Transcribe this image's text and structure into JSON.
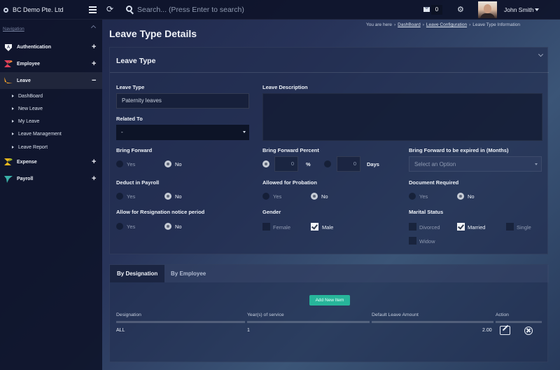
{
  "header": {
    "company": "BC Demo Pte. Ltd",
    "search_placeholder": "Search... (Press Enter to search)",
    "mail_count": "0",
    "user_name": "John Smith",
    "icons": [
      "hamburger-icon",
      "refresh-icon",
      "search-icon",
      "mail-icon",
      "gear-icon",
      "caret-down-icon"
    ]
  },
  "sidebar": {
    "title": "Navigation",
    "items": [
      {
        "label": "Authentication",
        "toggle": "+",
        "icon": "authentication-icon"
      },
      {
        "label": "Employee",
        "toggle": "+",
        "icon": "employee-icon"
      },
      {
        "label": "Leave",
        "toggle": "−",
        "icon": "leave-icon"
      },
      {
        "label": "Expense",
        "toggle": "+",
        "icon": "expense-icon"
      },
      {
        "label": "Payroll",
        "toggle": "+",
        "icon": "payroll-icon"
      }
    ],
    "leave_sub_items": [
      "DashBoard",
      "New Leave",
      "My Leave",
      "Leave Management",
      "Leave Report"
    ]
  },
  "page": {
    "title": "Leave Type Details",
    "breadcrumb": {
      "prefix": "You are here",
      "items": [
        "DashBoard",
        "Leave Configuration",
        "Leave Type Information"
      ]
    }
  },
  "form": {
    "card_title": "Leave Type",
    "leave_type": {
      "label": "Leave Type",
      "value": "Paternity leaves"
    },
    "leave_description": {
      "label": "Leave Description",
      "value": ""
    },
    "related_to": {
      "label": "Related To",
      "value": "-"
    },
    "bring_forward": {
      "label": "Bring Forward",
      "options": [
        "Yes",
        "No"
      ],
      "selected": "No"
    },
    "bring_forward_percent": {
      "label": "Bring Forward Percent",
      "percent_value": "0",
      "percent_unit": "%",
      "days_value": "0",
      "days_unit": "Days"
    },
    "bring_forward_expiry": {
      "label": "Bring Forward to be expired in (Months)",
      "placeholder": "Select an Option"
    },
    "deduct_in_payroll": {
      "label": "Deduct in Payroll",
      "options": [
        "Yes",
        "No"
      ],
      "selected": "No"
    },
    "allowed_for_probation": {
      "label": "Allowed for Probation",
      "options": [
        "Yes",
        "No"
      ],
      "selected": "No"
    },
    "document_required": {
      "label": "Document Required",
      "options": [
        "Yes",
        "No"
      ],
      "selected": "No"
    },
    "allow_for_resignation": {
      "label": "Allow for Resignation notice period",
      "options": [
        "Yes",
        "No"
      ],
      "selected": "No"
    },
    "gender": {
      "label": "Gender",
      "options": [
        "Female",
        "Male"
      ],
      "checked": [
        "Male"
      ]
    },
    "marital_status": {
      "label": "Marital Status",
      "options": [
        "Divorced",
        "Married",
        "Single",
        "Widow"
      ],
      "checked": [
        "Married"
      ]
    }
  },
  "tabs": {
    "items": [
      "By Designation",
      "By Employee"
    ],
    "active": "By Designation",
    "add_button": "Add New Item",
    "columns": [
      "Designation",
      "Year(s) of service",
      "Default Leave Amount",
      "Action"
    ],
    "rows": [
      {
        "designation": "ALL",
        "years": "1",
        "amount": "2.00"
      }
    ]
  }
}
